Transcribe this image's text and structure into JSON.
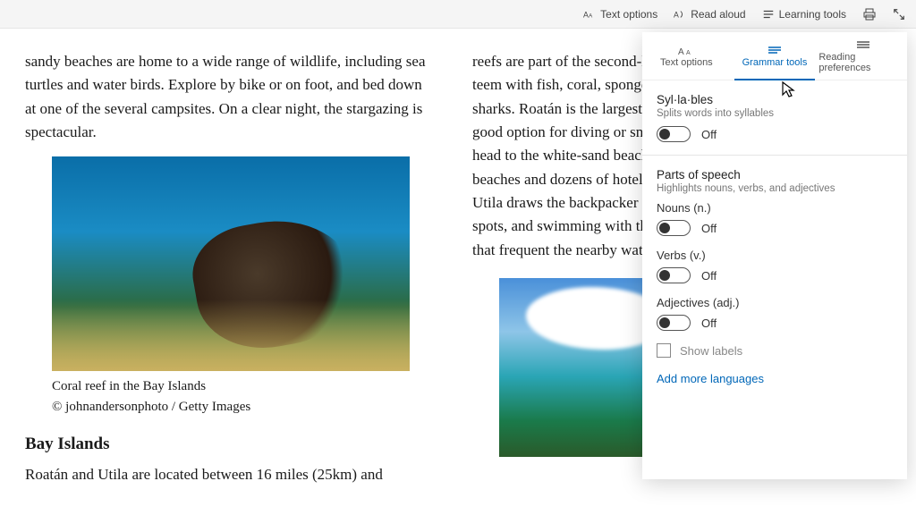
{
  "toolbar": {
    "text_options": "Text options",
    "read_aloud": "Read aloud",
    "learning_tools": "Learning tools"
  },
  "article": {
    "p1": "sandy beaches are home to a wide range of wildlife, including sea turtles and water birds. Explore by bike or on foot, and bed down at one of the several campsites. On a clear night, the stargazing is spectacular.",
    "caption1_line1": "Coral reef in the Bay Islands",
    "caption1_line2": "© johnandersonphoto / Getty Images",
    "heading": "Bay Islands",
    "p2": "Roatán and Utila are located between 16 miles (25km) and",
    "p3": "reefs are part of the second-largest barrier reef in the world, and teem with fish, coral, sponges, rays, sea turtles and even whale sharks. Roatán is the largest and most popular of the group and is a good option for diving or snorkeling. For a more relaxed beach day head to the white-sand beach of the West Bay. With two main beaches and dozens of hotels, restaurants, bars and dive shops, Utila draws the backpacker crowd. It has some fantastic diving spots, and swimming with the (harmless) juvenile whale sharks that frequent the nearby waters of the island."
  },
  "panel": {
    "tabs": {
      "text_options": "Text options",
      "grammar_tools": "Grammar tools",
      "reading_preferences": "Reading preferences"
    },
    "syllables": {
      "title": "Syl·la·bles",
      "desc": "Splits words into syllables",
      "state": "Off"
    },
    "pos": {
      "title": "Parts of speech",
      "desc": "Highlights nouns, verbs, and adjectives",
      "nouns_label": "Nouns (n.)",
      "nouns_state": "Off",
      "verbs_label": "Verbs (v.)",
      "verbs_state": "Off",
      "adjectives_label": "Adjectives (adj.)",
      "adjectives_state": "Off",
      "show_labels": "Show labels"
    },
    "add_languages": "Add more languages"
  }
}
